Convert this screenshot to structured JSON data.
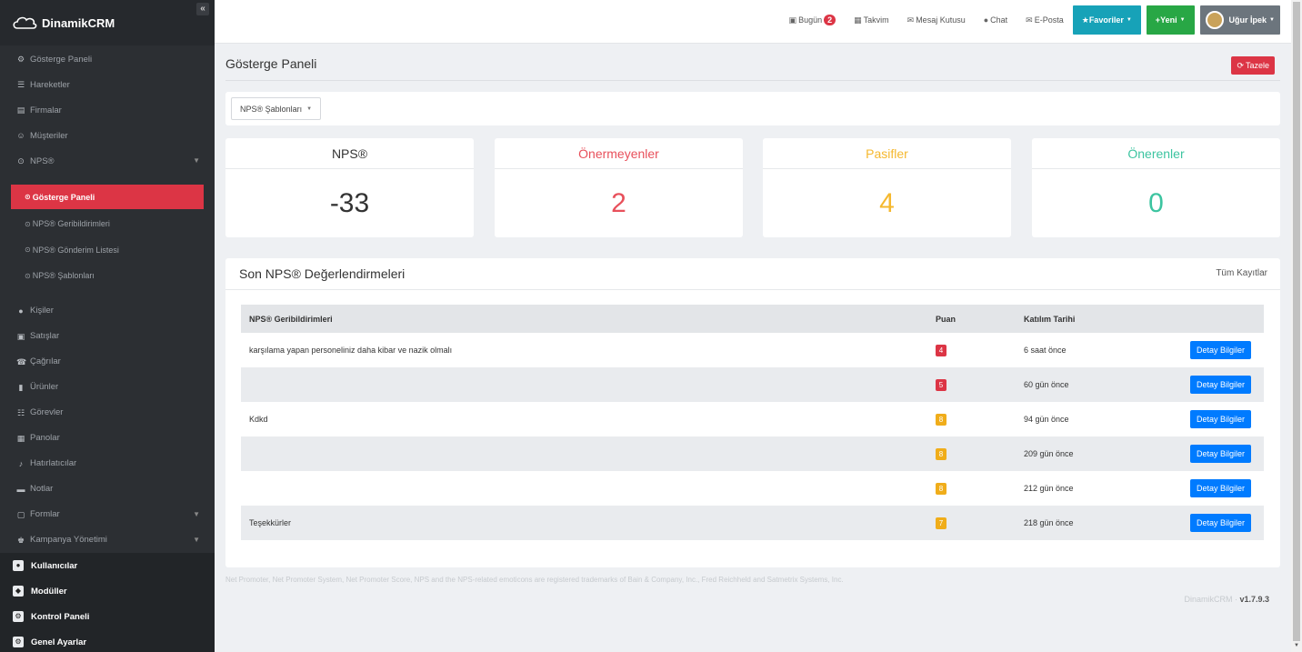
{
  "brand": {
    "name": "DinamikCRM",
    "collapse": "«"
  },
  "sidebar": {
    "items": [
      {
        "icon": "⚙",
        "label": "Gösterge Paneli"
      },
      {
        "icon": "☰",
        "label": "Hareketler"
      },
      {
        "icon": "▤",
        "label": "Firmalar"
      },
      {
        "icon": "☺",
        "label": "Müşteriler"
      },
      {
        "icon": "⊙",
        "label": "NPS®"
      }
    ],
    "submenu": [
      {
        "label": "Gösterge Paneli"
      },
      {
        "label": "NPS® Geribildirimleri"
      },
      {
        "label": "NPS® Gönderim Listesi"
      },
      {
        "label": "NPS® Şablonları"
      }
    ],
    "items2": [
      {
        "icon": "●",
        "label": "Kişiler"
      },
      {
        "icon": "▣",
        "label": "Satışlar"
      },
      {
        "icon": "☎",
        "label": "Çağrılar"
      },
      {
        "icon": "▮",
        "label": "Ürünler"
      },
      {
        "icon": "☷",
        "label": "Görevler"
      },
      {
        "icon": "▦",
        "label": "Panolar"
      },
      {
        "icon": "♪",
        "label": "Hatırlatıcılar"
      },
      {
        "icon": "▬",
        "label": "Notlar"
      },
      {
        "icon": "▢",
        "label": "Formlar"
      },
      {
        "icon": "♚",
        "label": "Kampanya Yönetimi"
      }
    ],
    "bottom": [
      {
        "icon": "●",
        "label": "Kullanıcılar"
      },
      {
        "icon": "◆",
        "label": "Modüller"
      },
      {
        "icon": "⚙",
        "label": "Kontrol Paneli"
      },
      {
        "icon": "⚙",
        "label": "Genel Ayarlar"
      }
    ]
  },
  "topbar": {
    "today": "Bugün",
    "today_count": "2",
    "calendar": "Takvim",
    "inbox": "Mesaj Kutusu",
    "chat": "Chat",
    "email": "E-Posta",
    "favorites": "Favoriler",
    "new": "Yeni",
    "user": "Uğur İpek"
  },
  "page": {
    "title": "Gösterge Paneli",
    "refresh": "Tazele",
    "templates": "NPS® Şablonları"
  },
  "cards": [
    {
      "title": "NPS®",
      "value": "-33",
      "color": "#333333"
    },
    {
      "title": "Önermeyenler",
      "value": "2",
      "color": "#e8505b"
    },
    {
      "title": "Pasifler",
      "value": "4",
      "color": "#f5b82e"
    },
    {
      "title": "Önerenler",
      "value": "0",
      "color": "#3cc4a0"
    }
  ],
  "recent": {
    "title": "Son NPS® Değerlendirmeleri",
    "all_records": "Tüm Kayıtlar",
    "columns": [
      "NPS® Geribildirimleri",
      "Puan",
      "Katılım Tarihi"
    ],
    "detail_label": "Detay Bilgiler",
    "rows": [
      {
        "feedback": "karşılama yapan personeliniz daha kibar ve nazik olmalı",
        "score": "4",
        "score_color": "#dc3545",
        "date": "6 saat önce"
      },
      {
        "feedback": "",
        "score": "5",
        "score_color": "#dc3545",
        "date": "60 gün önce"
      },
      {
        "feedback": "Kdkd",
        "score": "8",
        "score_color": "#f0ad1a",
        "date": "94 gün önce"
      },
      {
        "feedback": "",
        "score": "8",
        "score_color": "#f0ad1a",
        "date": "209 gün önce"
      },
      {
        "feedback": "",
        "score": "8",
        "score_color": "#f0ad1a",
        "date": "212 gün önce"
      },
      {
        "feedback": "Teşekkürler",
        "score": "7",
        "score_color": "#f0ad1a",
        "date": "218 gün önce"
      }
    ]
  },
  "footer": {
    "note": "Net Promoter, Net Promoter System, Net Promoter Score, NPS and the NPS-related emoticons are registered trademarks of Bain & Company, Inc., Fred Reichheld and Satmetrix Systems, Inc.",
    "product": "DinamikCRM",
    "version": "v1.7.9.3"
  }
}
